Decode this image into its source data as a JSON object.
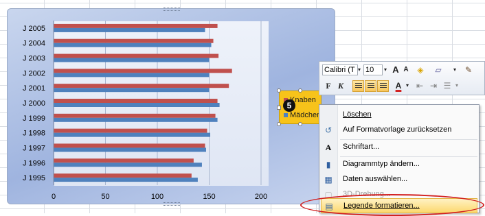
{
  "chart_data": {
    "type": "bar",
    "orientation": "horizontal",
    "categories": [
      "J 1995",
      "J 1996",
      "J 1997",
      "J 1998",
      "J 1999",
      "J 2000",
      "J 2001",
      "J 2002",
      "J 2003",
      "J 2004",
      "J 2005"
    ],
    "series": [
      {
        "name": "Knaben",
        "color": "#c0504d",
        "values": [
          133,
          135,
          146,
          148,
          156,
          158,
          169,
          172,
          159,
          154,
          158
        ]
      },
      {
        "name": "Mädchen",
        "color": "#4f81bd",
        "values": [
          139,
          143,
          147,
          151,
          158,
          160,
          150,
          150,
          150,
          152,
          146
        ]
      }
    ],
    "xticks": [
      0,
      50,
      100,
      150,
      200
    ],
    "xlim": [
      0,
      200
    ],
    "grid": true,
    "legend_position": "right"
  },
  "legend": {
    "items": [
      {
        "label": "Knaben",
        "color": "#c0504d"
      },
      {
        "label": "Mädchen",
        "color": "#4f81bd"
      }
    ]
  },
  "step_badge": "5",
  "mini_toolbar": {
    "font_name": "Calibri (T",
    "font_size": "10",
    "grow_font": "A",
    "shrink_font": "A",
    "bold": "F",
    "italic": "K",
    "font_color": "A"
  },
  "context_menu": {
    "items": [
      {
        "label": "Löschen",
        "icon": "delete-icon",
        "glyph": "",
        "disabled": false
      },
      {
        "label": "Auf Formatvorlage zurücksetzen",
        "icon": "reset-style-icon",
        "glyph": "↺",
        "disabled": false
      },
      {
        "label": "Schriftart...",
        "icon": "font-icon",
        "glyph": "A",
        "disabled": false
      },
      {
        "label": "Diagrammtyp ändern...",
        "icon": "chart-type-icon",
        "glyph": "▮",
        "disabled": false
      },
      {
        "label": "Daten auswählen...",
        "icon": "select-data-icon",
        "glyph": "▦",
        "disabled": false
      },
      {
        "label": "3D-Drehung...",
        "icon": "3d-rotation-icon",
        "glyph": "▢",
        "disabled": true
      },
      {
        "label": "Legende formatieren...",
        "icon": "format-legend-icon",
        "glyph": "▤",
        "disabled": false,
        "highlighted": true
      }
    ]
  },
  "colors": {
    "highlight_ellipse": "#d22222",
    "legend_background": "#f7c31a"
  }
}
